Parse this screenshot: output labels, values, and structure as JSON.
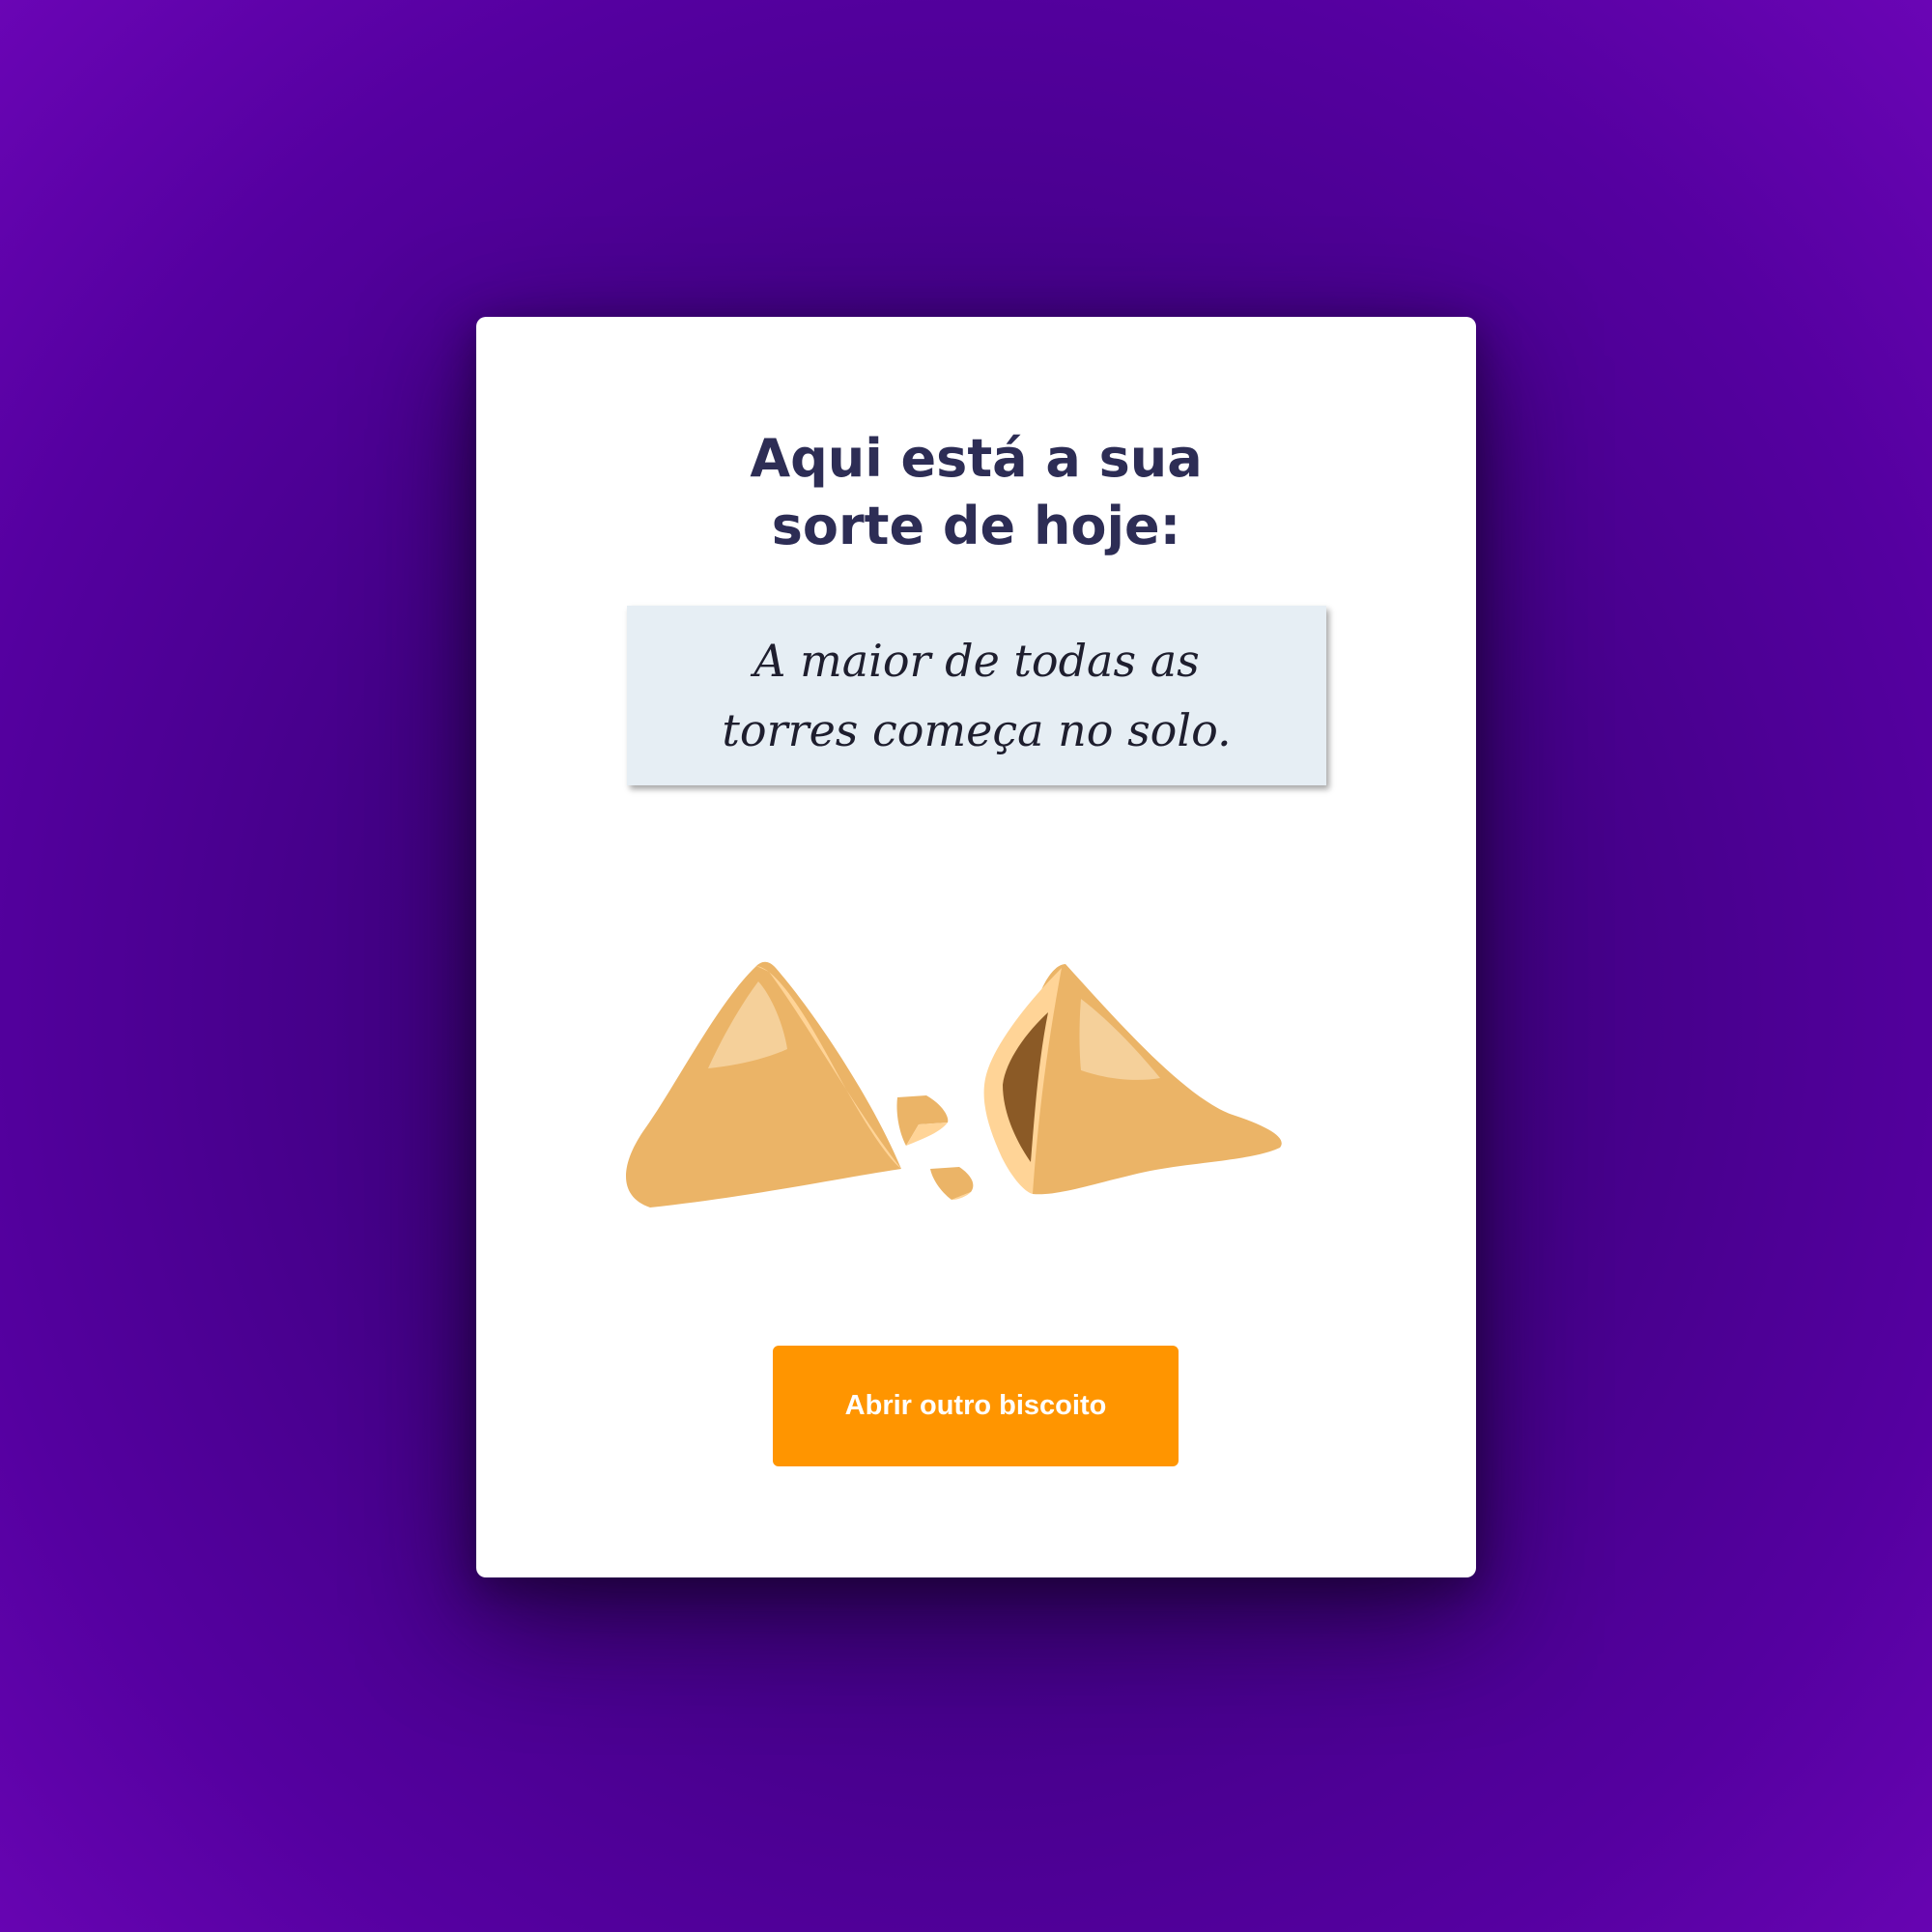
{
  "card": {
    "title": "Aqui está a sua sorte de hoje:",
    "fortune": "A maior de todas as torres começa no solo.",
    "button_label": "Abrir outro biscoito"
  },
  "illustration": {
    "icon": "broken-fortune-cookie-icon"
  },
  "colors": {
    "background": "#4a0090",
    "card": "#ffffff",
    "title": "#2d2d55",
    "paper": "#e6eef4",
    "button": "#ff9500",
    "cookie": "#ebb467"
  }
}
